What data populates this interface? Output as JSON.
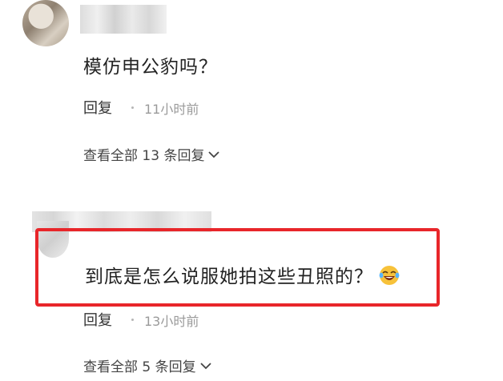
{
  "comments": [
    {
      "text": "模仿申公豹吗？",
      "reply_label": "回复",
      "time": "11小时前",
      "view_replies": "查看全部 13 条回复"
    },
    {
      "text": "到底是怎么说服她拍这些丑照的？",
      "emoji": "laughing-tears-emoji",
      "reply_label": "回复",
      "time": "13小时前",
      "view_replies": "查看全部 5 条回复"
    }
  ],
  "colors": {
    "highlight_border": "#e8262a",
    "time_text": "#9a9a9a",
    "body_text": "#222222"
  }
}
